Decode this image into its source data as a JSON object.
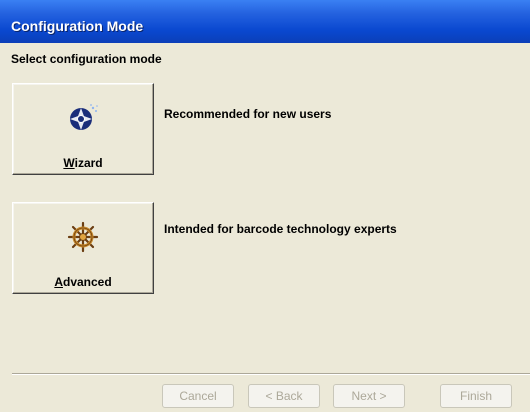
{
  "window": {
    "title": "Configuration Mode"
  },
  "heading": "Select configuration mode",
  "options": [
    {
      "label_prefix": "",
      "label_mnemonic": "W",
      "label_rest": "izard",
      "description": "Recommended for new users",
      "icon": "wizard-icon"
    },
    {
      "label_prefix": "",
      "label_mnemonic": "A",
      "label_rest": "dvanced",
      "description": "Intended for barcode technology experts",
      "icon": "ships-wheel-icon"
    }
  ],
  "nav": {
    "cancel": "Cancel",
    "back": "< Back",
    "next": "Next >",
    "finish": "Finish"
  },
  "colors": {
    "titlebar": "#0a48d0",
    "dialog_bg": "#ece9d8",
    "disabled_text": "#aca899"
  }
}
